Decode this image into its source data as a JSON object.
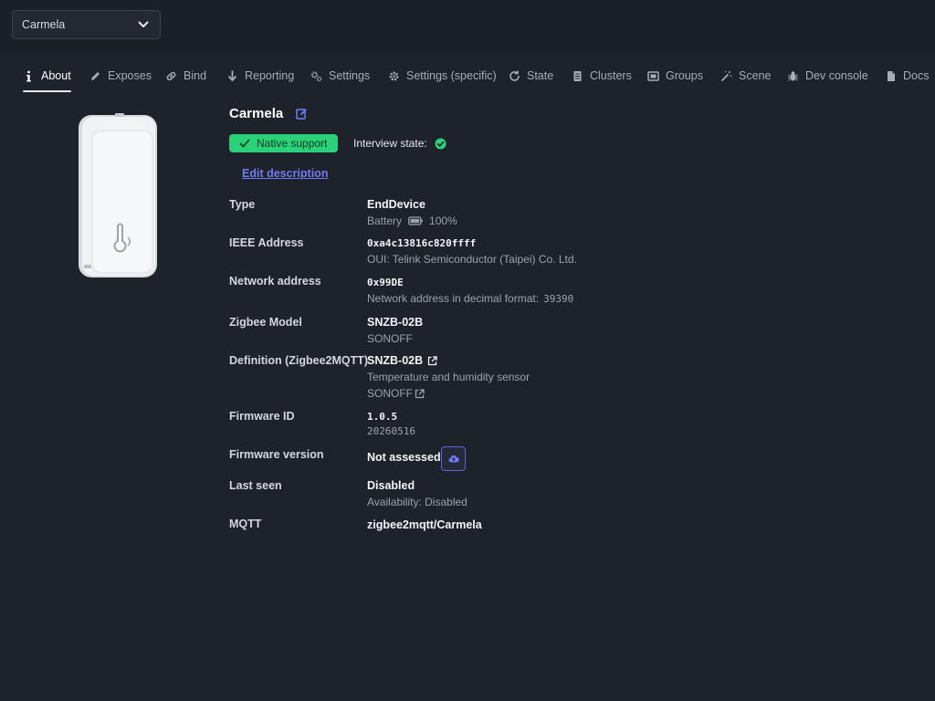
{
  "device_select": {
    "value": "Carmela"
  },
  "tabs": [
    {
      "label": "About",
      "icon": "info-icon"
    },
    {
      "label": "Exposes",
      "icon": "pencil-icon"
    },
    {
      "label": "Bind",
      "icon": "link-icon"
    },
    {
      "label": "Reporting",
      "icon": "arrow-down-icon"
    },
    {
      "label": "Settings",
      "icon": "gears-icon"
    },
    {
      "label": "Settings (specific)",
      "icon": "gear-icon"
    },
    {
      "label": "State",
      "icon": "refresh-icon"
    },
    {
      "label": "Clusters",
      "icon": "document-icon"
    },
    {
      "label": "Groups",
      "icon": "group-icon"
    },
    {
      "label": "Scene",
      "icon": "magic-wand-icon"
    },
    {
      "label": "Dev console",
      "icon": "bug-icon"
    },
    {
      "label": "Docs",
      "icon": "file-icon"
    }
  ],
  "device": {
    "name": "Carmela",
    "support_badge": "Native support",
    "interview_label": "Interview state:",
    "edit_description": "Edit description"
  },
  "details": {
    "type": {
      "label": "Type",
      "value": "EndDevice",
      "battery_label": "Battery",
      "battery_value": "100%"
    },
    "ieee": {
      "label": "IEEE Address",
      "value": "0xa4c13816c820ffff",
      "oui": "OUI: Telink Semiconductor (Taipei) Co. Ltd."
    },
    "network": {
      "label": "Network address",
      "value": "0x99DE",
      "decimal_label": "Network address in decimal format:",
      "decimal_value": "39390"
    },
    "model": {
      "label": "Zigbee Model",
      "value": "SNZB-02B",
      "vendor": "SONOFF"
    },
    "definition": {
      "label": "Definition (Zigbee2MQTT)",
      "value": "SNZB-02B",
      "description": "Temperature and humidity sensor",
      "vendor": "SONOFF"
    },
    "firmware_id": {
      "label": "Firmware ID",
      "value": "1.0.5",
      "date": "20260516"
    },
    "firmware_version": {
      "label": "Firmware version",
      "value": "Not assessed"
    },
    "last_seen": {
      "label": "Last seen",
      "value": "Disabled",
      "availability": "Availability: Disabled"
    },
    "mqtt": {
      "label": "MQTT",
      "value": "zigbee2mqtt/Carmela"
    }
  },
  "colors": {
    "background": "#1e222a",
    "accent": "#6f7cf5",
    "success": "#2bd07a"
  }
}
